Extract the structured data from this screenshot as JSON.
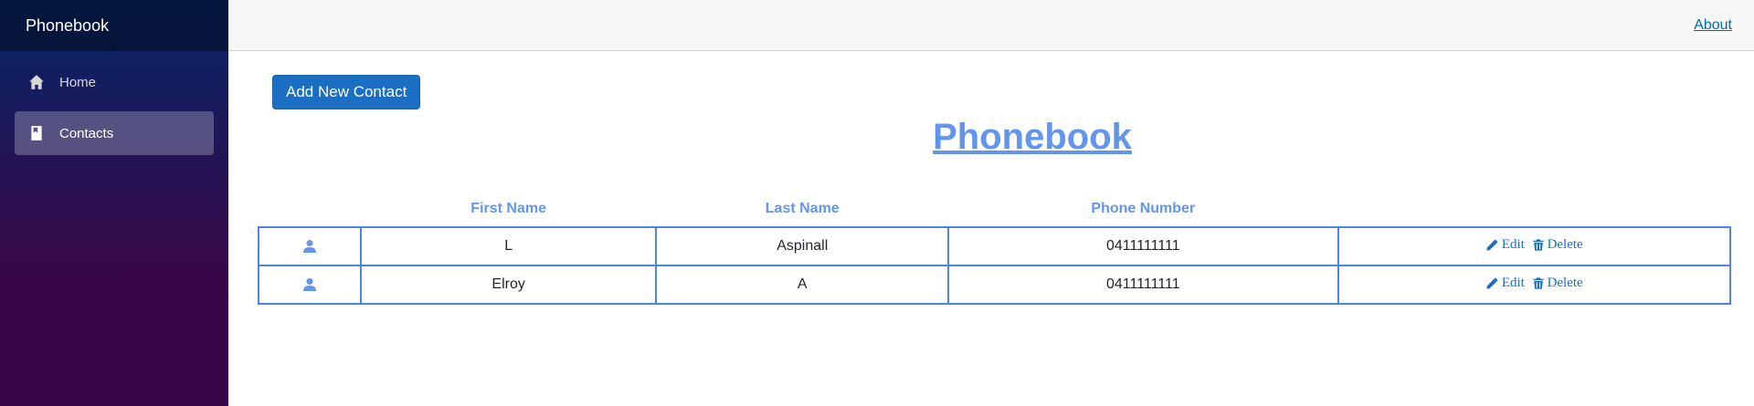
{
  "sidebar": {
    "brand": "Phonebook",
    "items": [
      {
        "label": "Home",
        "icon": "home-icon",
        "active": false
      },
      {
        "label": "Contacts",
        "icon": "book-icon",
        "active": true
      }
    ]
  },
  "top_row": {
    "about_label": "About"
  },
  "main": {
    "add_button_label": "Add New Contact",
    "title": "Phonebook",
    "table": {
      "headers": [
        "",
        "First Name",
        "Last Name",
        "Phone Number",
        ""
      ],
      "rows": [
        {
          "first_name": "L",
          "last_name": "Aspinall",
          "phone": "0411111111"
        },
        {
          "first_name": "Elroy",
          "last_name": "A",
          "phone": "0411111111"
        }
      ],
      "edit_label": "Edit",
      "delete_label": "Delete"
    }
  },
  "colors": {
    "accent": "#6495ed",
    "button": "#1b6ec2",
    "sidebar_top": "#052767",
    "sidebar_bottom": "#3a0647"
  }
}
